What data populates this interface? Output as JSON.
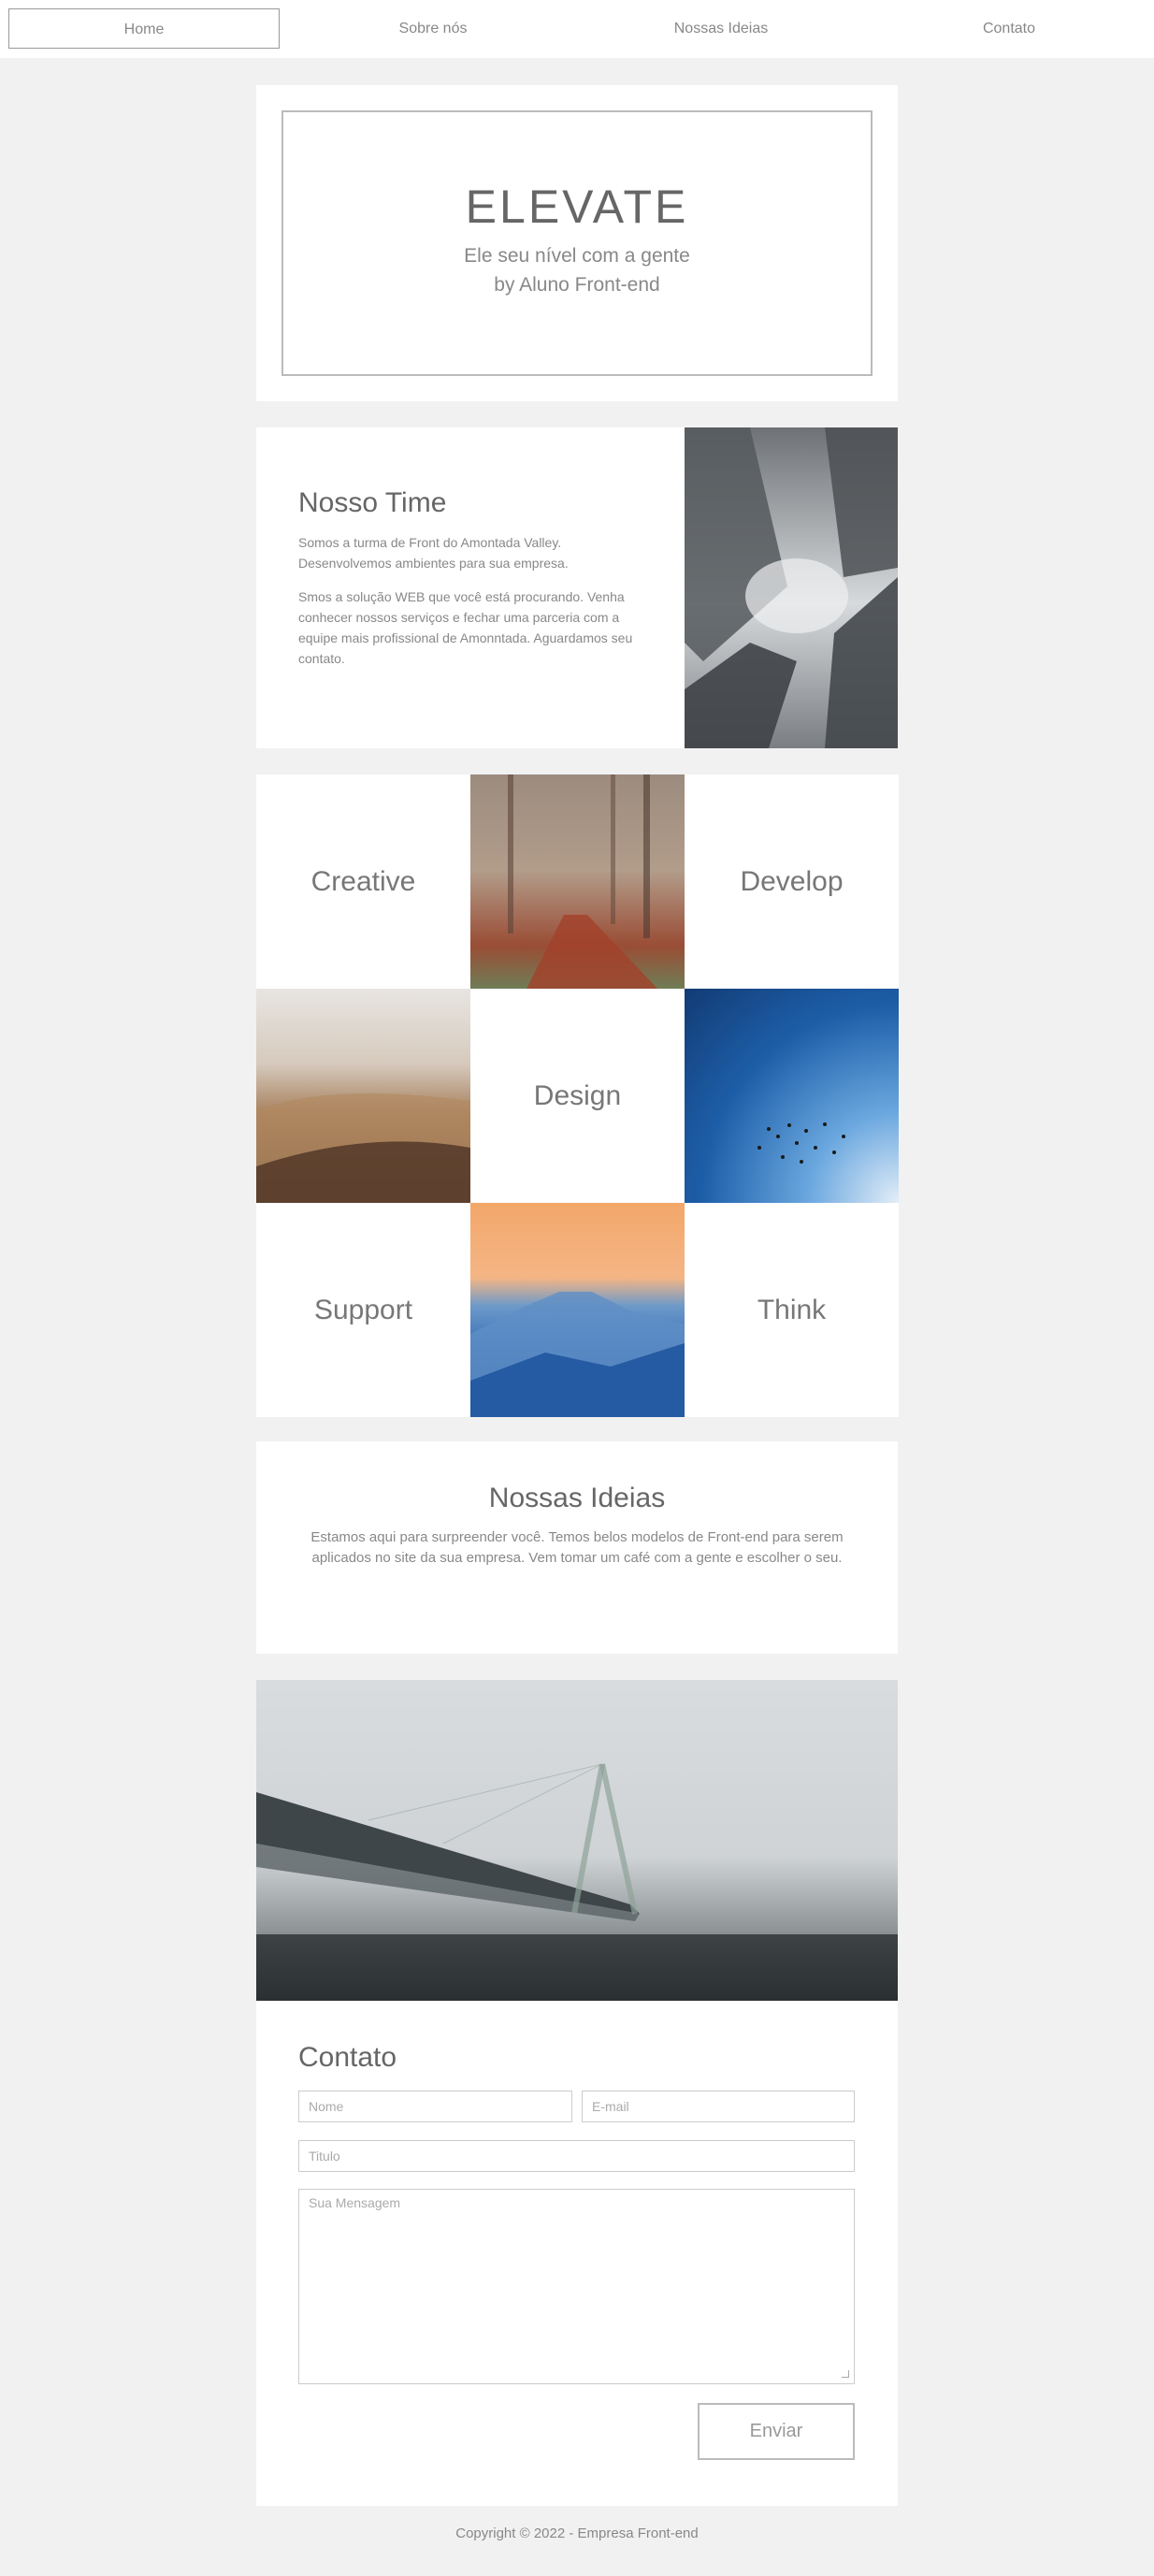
{
  "nav": {
    "items": [
      "Home",
      "Sobre nós",
      "Nossas Ideias",
      "Contato"
    ]
  },
  "hero": {
    "title": "ELEVATE",
    "subtitle": "Ele seu nível com a gente",
    "byline": "by Aluno Front-end"
  },
  "team": {
    "title": "Nosso Time",
    "p1": "Somos a turma de Front do Amontada Valley. Desenvolvemos ambientes para sua empresa.",
    "p2": "Smos a solução WEB que você está procurando. Venha conhecer nossos serviços e fechar uma parceria com a equipe mais profissional de Amonntada. Aguardamos seu contato."
  },
  "grid": {
    "words": [
      "Creative",
      "Develop",
      "Design",
      "Support",
      "Think"
    ]
  },
  "ideias": {
    "title": "Nossas Ideias",
    "text": "Estamos aqui para surpreender você. Temos belos modelos de Front-end para serem aplicados no site da sua empresa. Vem tomar um café com a gente e escolher o seu."
  },
  "contact": {
    "title": "Contato",
    "name_placeholder": "Nome",
    "email_placeholder": "E-mail",
    "title_placeholder": "Titulo",
    "message_placeholder": "Sua Mensagem",
    "submit_label": "Enviar"
  },
  "footer": {
    "copyright": "Copyright © 2022 - Empresa Front-end"
  }
}
